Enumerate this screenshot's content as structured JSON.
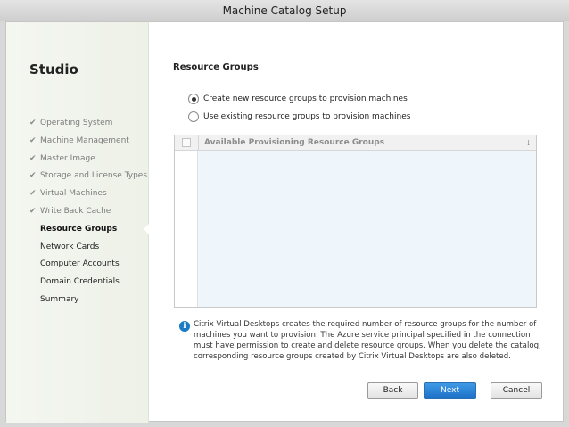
{
  "window": {
    "title": "Machine Catalog Setup"
  },
  "sidebar": {
    "app_name": "Studio",
    "steps": [
      {
        "label": "Operating System",
        "state": "done"
      },
      {
        "label": "Machine Management",
        "state": "done"
      },
      {
        "label": "Master Image",
        "state": "done"
      },
      {
        "label": "Storage and License Types",
        "state": "done"
      },
      {
        "label": "Virtual Machines",
        "state": "done"
      },
      {
        "label": "Write Back Cache",
        "state": "done"
      },
      {
        "label": "Resource Groups",
        "state": "active"
      },
      {
        "label": "Network Cards",
        "state": "todo"
      },
      {
        "label": "Computer Accounts",
        "state": "todo"
      },
      {
        "label": "Domain Credentials",
        "state": "todo"
      },
      {
        "label": "Summary",
        "state": "todo"
      }
    ],
    "check_glyph": "✔"
  },
  "main": {
    "heading": "Resource Groups",
    "options": [
      {
        "label": "Create new resource groups to provision machines",
        "selected": true
      },
      {
        "label": "Use existing resource groups to provision machines",
        "selected": false
      }
    ],
    "table": {
      "column_header": "Available Provisioning Resource Groups",
      "sort_icon": "↓",
      "rows": []
    },
    "info": {
      "icon": "i",
      "text": "Citrix Virtual Desktops creates the required number of resource groups for the number of machines you want to provision. The Azure service principal specified in the connection must have permission to create and delete resource groups. When you delete the catalog, corresponding resource groups created by Citrix Virtual Desktops are also deleted."
    }
  },
  "buttons": {
    "back": "Back",
    "next": "Next",
    "cancel": "Cancel"
  },
  "colors": {
    "accent": "#1c6fc6",
    "info_icon": "#1b7bc4",
    "table_body": "#eef5fb"
  }
}
